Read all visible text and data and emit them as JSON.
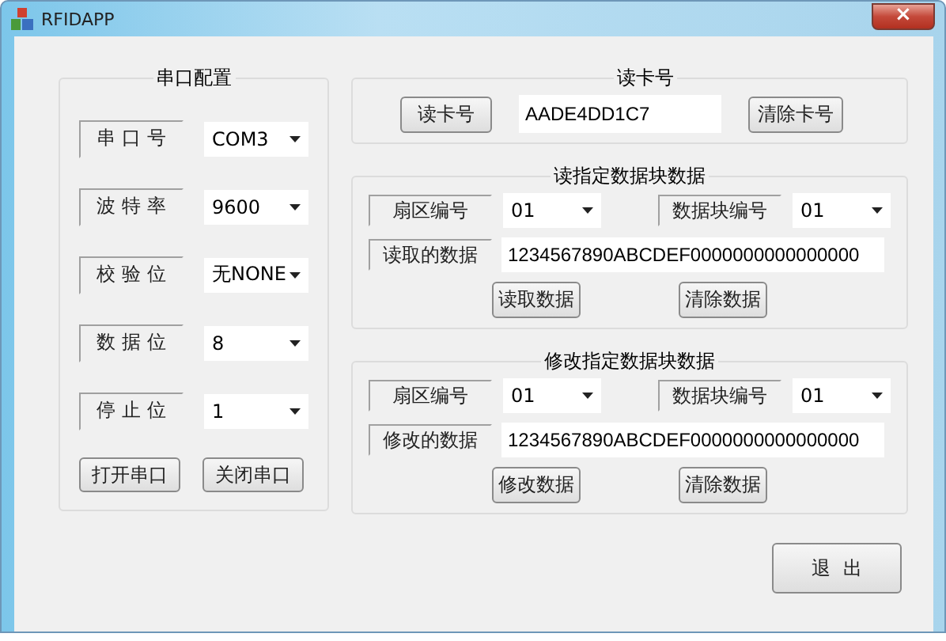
{
  "window": {
    "title": "RFIDAPP",
    "close": "×"
  },
  "serial_config": {
    "title": "串口配置",
    "fields": [
      {
        "label": "串 口 号",
        "value": "COM3"
      },
      {
        "label": "波 特 率",
        "value": "9600"
      },
      {
        "label": "校 验 位",
        "value": "无NONE"
      },
      {
        "label": "数 据 位",
        "value": "8"
      },
      {
        "label": "停 止 位",
        "value": "1"
      }
    ],
    "buttons": [
      "打开串口",
      "关闭串口"
    ]
  },
  "read_card": {
    "title": "读卡号",
    "read_button": "读卡号",
    "card_number": "AADE4DD1C7",
    "clear_button": "清除卡号"
  },
  "read_block": {
    "title": "读指定数据块数据",
    "sector_label": "扇区编号",
    "sector": "01",
    "block_label": "数据块编号",
    "block": "01",
    "data_label": "读取的数据",
    "data": "1234567890ABCDEF0000000000000000",
    "buttons": [
      "读取数据",
      "清除数据"
    ]
  },
  "write_block": {
    "title": "修改指定数据块数据",
    "sector_label": "扇区编号",
    "sector": "01",
    "block_label": "数据块编号",
    "block": "01",
    "data_label": "修改的数据",
    "data": "1234567890ABCDEF0000000000000000",
    "buttons": [
      "修改数据",
      "清除数据"
    ]
  },
  "exit_button": "退  出"
}
